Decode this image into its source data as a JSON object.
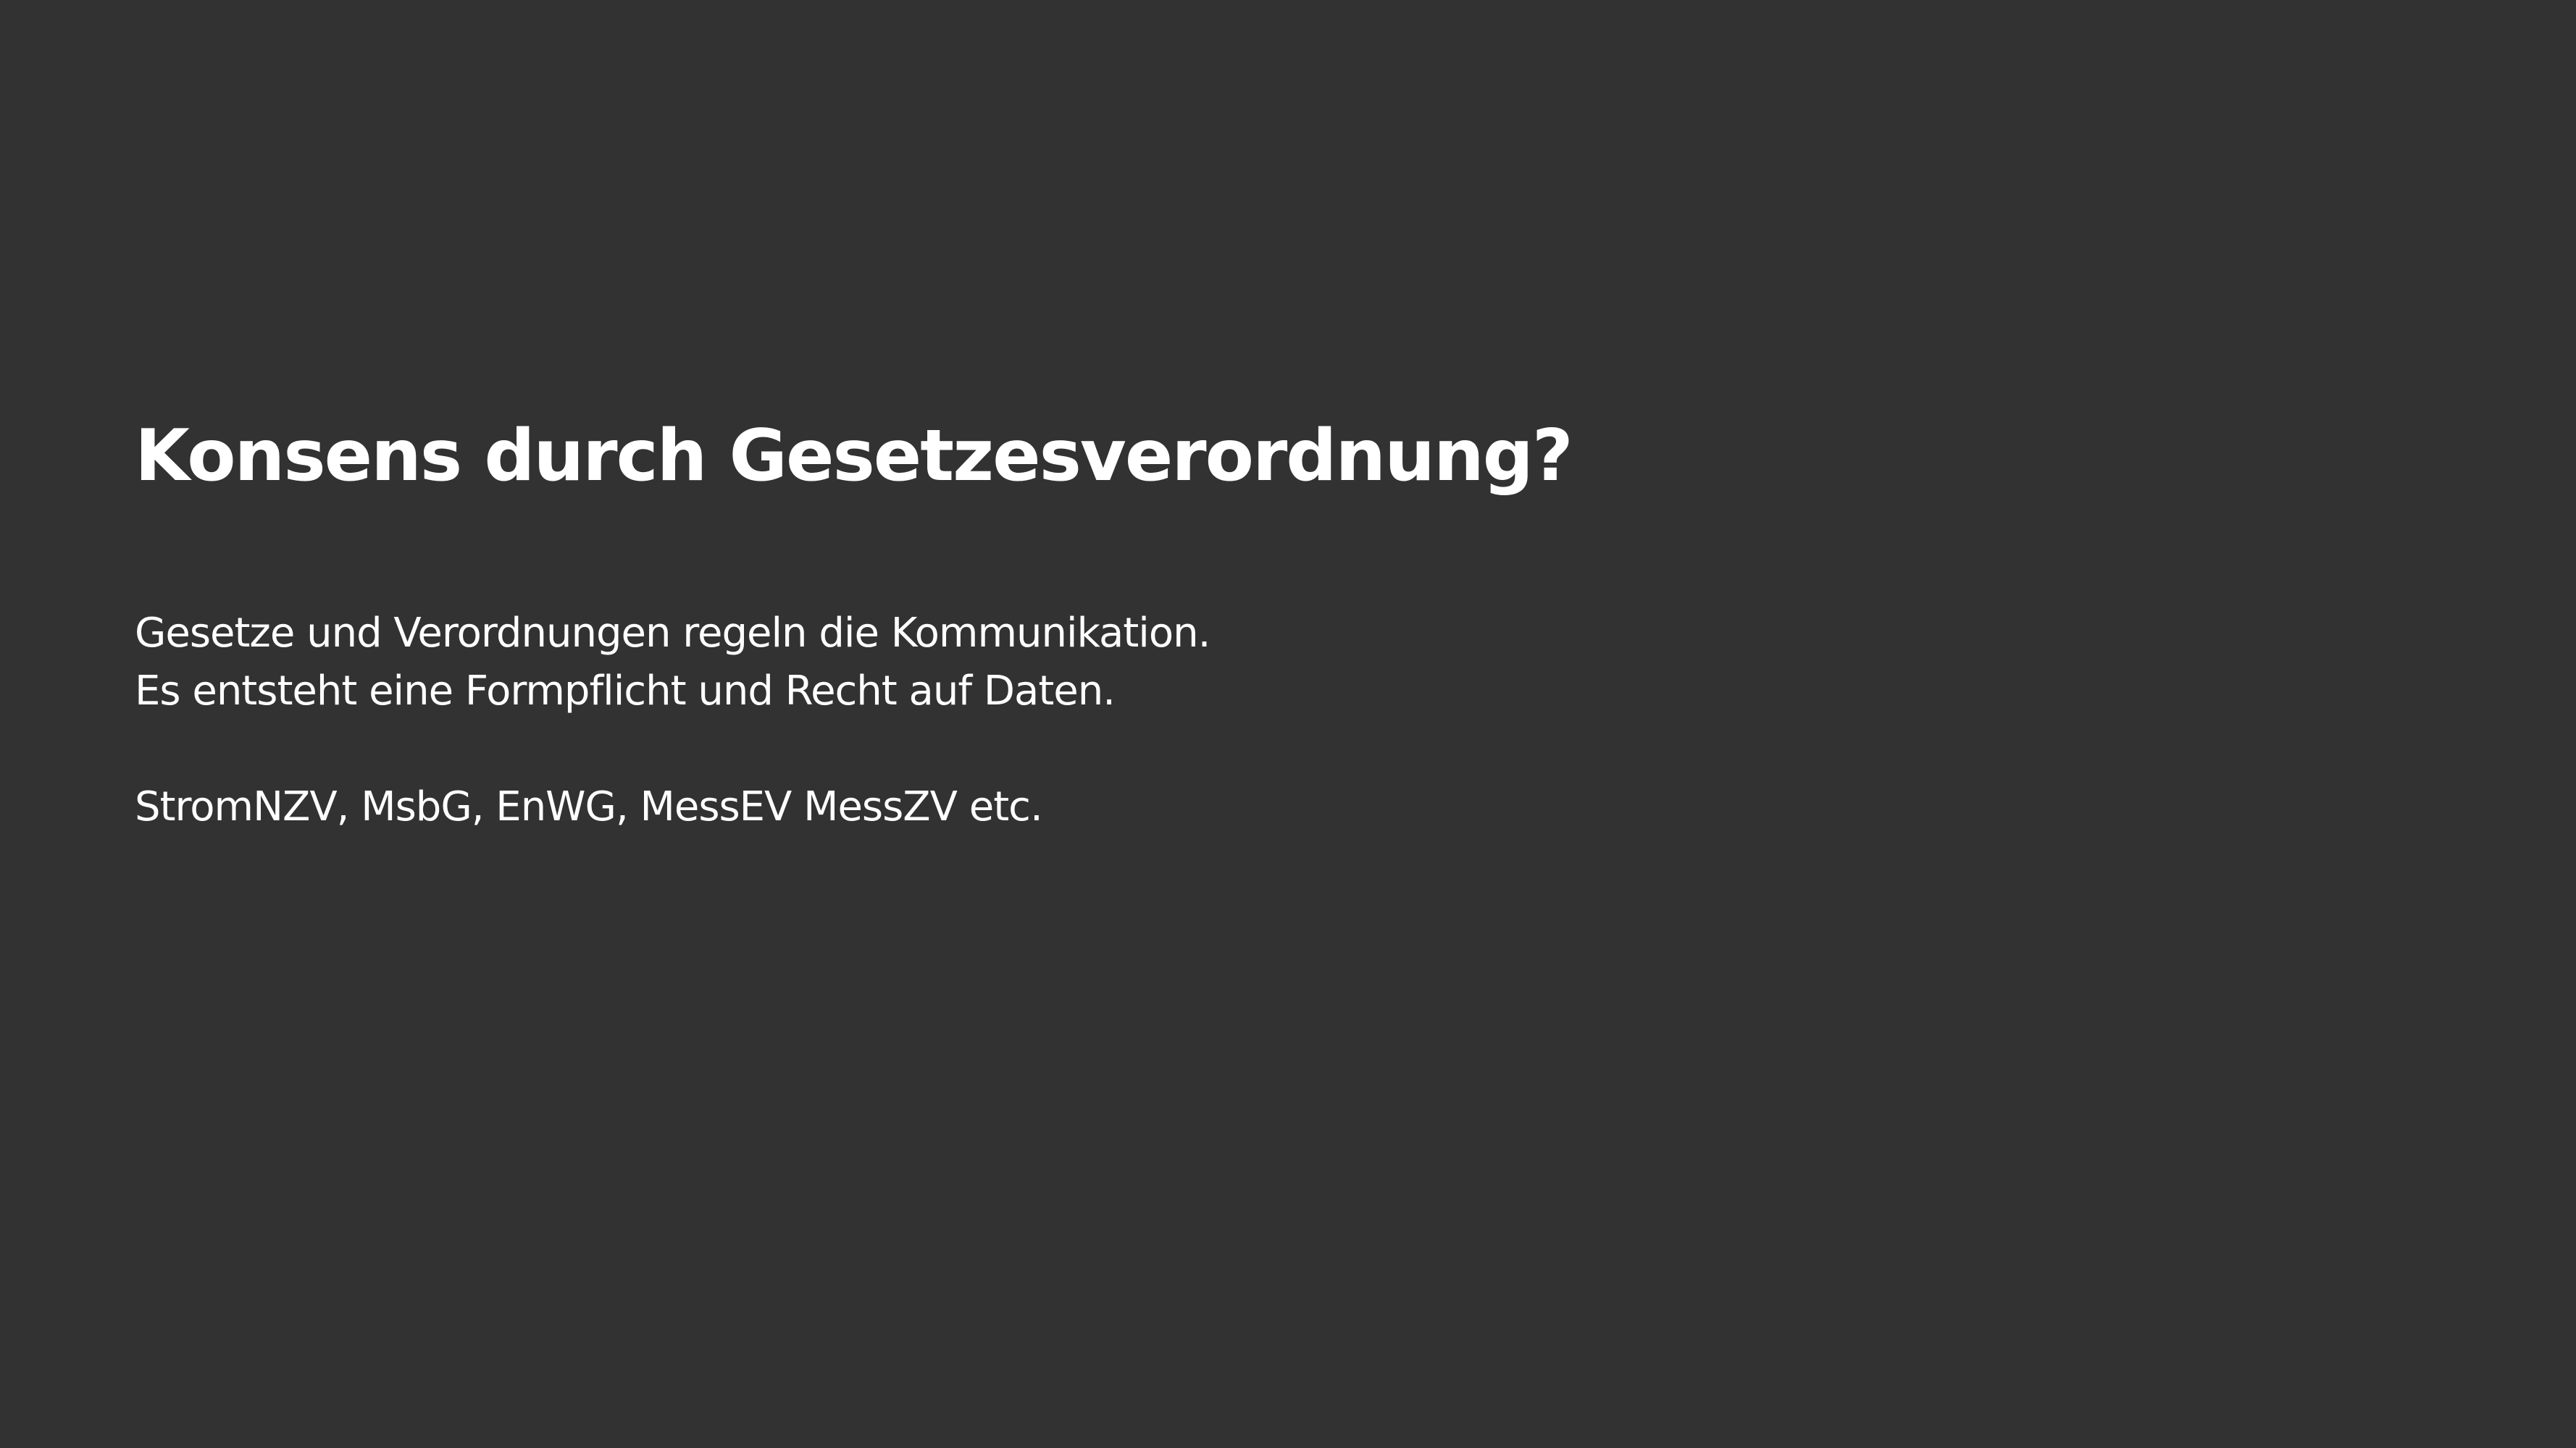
{
  "slide": {
    "title": "Konsens durch Gesetzesverordnung?",
    "lines": [
      "Gesetze und Verordnungen regeln die Kommunikation.",
      "Es entsteht eine Formpflicht und Recht auf Daten.",
      "StromNZV, MsbG, EnWG, MessEV MessZV etc."
    ]
  },
  "colors": {
    "background": "#323232",
    "text": "#ffffff"
  }
}
